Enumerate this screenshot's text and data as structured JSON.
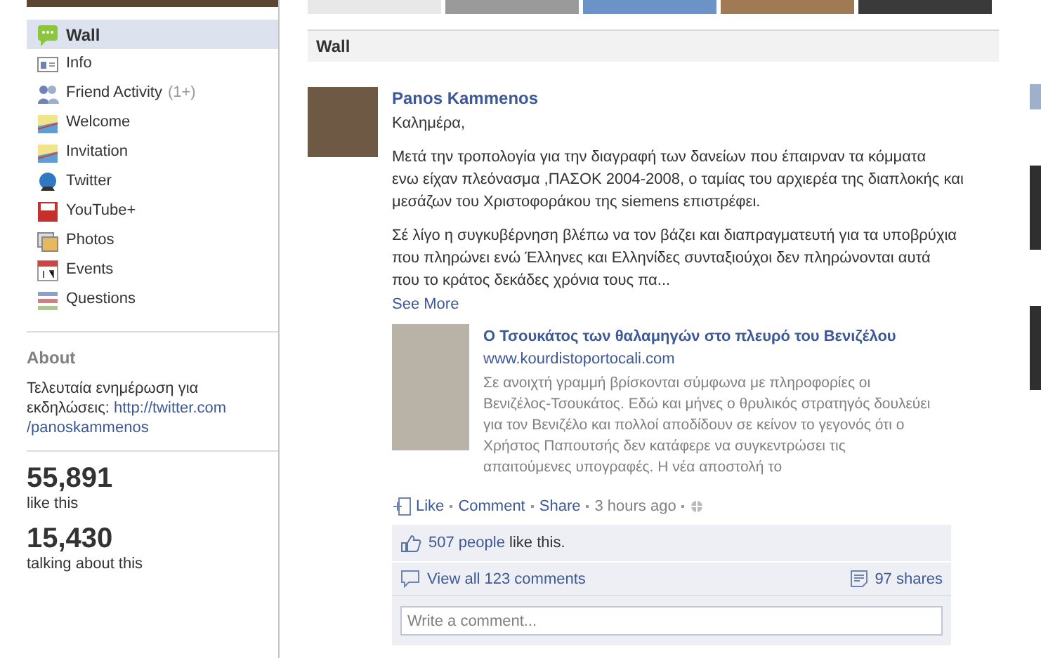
{
  "sidebar": {
    "nav": [
      {
        "label": "Wall",
        "kind": "wall",
        "selected": true
      },
      {
        "label": "Info",
        "kind": "info",
        "selected": false
      },
      {
        "label": "Friend Activity",
        "count": "(1+)",
        "kind": "friends",
        "selected": false
      },
      {
        "label": "Welcome",
        "kind": "app",
        "selected": false
      },
      {
        "label": "Invitation",
        "kind": "app",
        "selected": false
      },
      {
        "label": "Twitter",
        "kind": "twitter",
        "selected": false
      },
      {
        "label": "YouTube+",
        "kind": "youtube",
        "selected": false
      },
      {
        "label": "Photos",
        "kind": "photos",
        "selected": false
      },
      {
        "label": "Events",
        "kind": "events",
        "selected": false
      },
      {
        "label": "Questions",
        "kind": "questions",
        "selected": false
      }
    ],
    "about": {
      "heading": "About",
      "text": "Τελευταία ενημέρωση για εκδηλώσεις:",
      "link": [
        "http://twitter.com",
        "/panoskammenos"
      ]
    },
    "stats": [
      {
        "value": "55,891",
        "label": "like this"
      },
      {
        "value": "15,430",
        "label": "talking about this"
      }
    ]
  },
  "wall": {
    "heading": "Wall",
    "post": {
      "author": "Panos Kammenos",
      "paragraphs": [
        [
          "Καλημέρα,"
        ],
        [
          "Μετά την τροπολογία για την διαγραφή των δανείων που έπαιρναν τα κόμματα",
          "ενω είχαν πλεόνασμα ,ΠΑΣΟΚ 2004-2008, ο ταμίας του αρχιερέα της διαπλοκής και",
          "μεσάζων του Χριστοφοράκου της siemens επιστρέφει."
        ],
        [
          "Σέ λίγο η συγκυβέρνηση βλέπω να τον βάζει και διαπραγματευτή για τα υποβρύχια",
          "που πληρώνει ενώ Έλληνες και Ελληνίδες συνταξιούχοι δεν πληρώνονται αυτά",
          "που το κράτος δεκάδες χρόνια τους πα..."
        ]
      ],
      "see_more": "See More",
      "attachment": {
        "title": "Ο Τσουκάτος των θαλαμηγών στο πλευρό του Βενιζέλου",
        "url": "www.kourdistoportocali.com",
        "lines": [
          "Σε ανοιχτή γραμμή βρίσκονται σύμφωνα με πληροφορίες οι",
          "Βενιζέλος-Τσουκάτος. Εδώ και μήνες ο θρυλικός στρατηγός δουλεύει",
          "για τον Βενιζέλο και πολλοί αποδίδουν σε κείνον το γεγονός ότι ο",
          "Χρήστος Παπουτσής δεν κατάφερε να συγκεντρώσει τις",
          "απαιτούμενες υπογραφές. Η νέα αποστολή το"
        ]
      },
      "actions": [
        "Like",
        "Comment",
        "Share"
      ],
      "time": "3 hours ago",
      "likes": {
        "count_link": "507 people",
        "text": "like this."
      },
      "comments_link": "View all 123 comments",
      "shares": "97 shares",
      "comment_placeholder": "Write a comment..."
    }
  }
}
